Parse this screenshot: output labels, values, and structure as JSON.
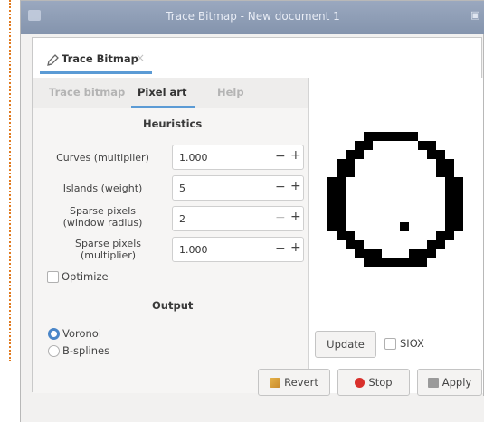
{
  "window": {
    "title": "Trace Bitmap - New document 1"
  },
  "dock_tab": {
    "label": "Trace Bitmap",
    "close": "×"
  },
  "subtabs": [
    {
      "label": "Trace bitmap",
      "active": false
    },
    {
      "label": "Pixel art",
      "active": true
    },
    {
      "label": "Help",
      "active": false
    }
  ],
  "heuristics": {
    "heading": "Heuristics",
    "curves": {
      "label": "Curves (multiplier)",
      "value": "1.000"
    },
    "islands": {
      "label": "Islands (weight)",
      "value": "5"
    },
    "sparse_radius": {
      "label_line1": "Sparse pixels",
      "label_line2": "(window radius)",
      "value": "2"
    },
    "sparse_mult": {
      "label_line1": "Sparse pixels",
      "label_line2": "(multiplier)",
      "value": "1.000"
    },
    "stepper_minus": "−",
    "stepper_plus": "+"
  },
  "optimize": {
    "label": "Optimize",
    "checked": false
  },
  "output": {
    "heading": "Output",
    "options": [
      {
        "label": "Voronoi",
        "selected": true
      },
      {
        "label": "B-splines",
        "selected": false
      }
    ]
  },
  "preview_actions": {
    "update_label": "Update",
    "siox_label": "SIOX",
    "siox_checked": false
  },
  "buttons": {
    "revert": "Revert",
    "stop": "Stop",
    "apply": "Apply"
  },
  "colors": {
    "accent": "#5b9bd5",
    "stop_red": "#d9302c",
    "titlebar": "#8f9db6"
  },
  "icons": [
    "pen-icon",
    "revert-icon",
    "stop-icon",
    "apply-icon",
    "close-icon"
  ]
}
